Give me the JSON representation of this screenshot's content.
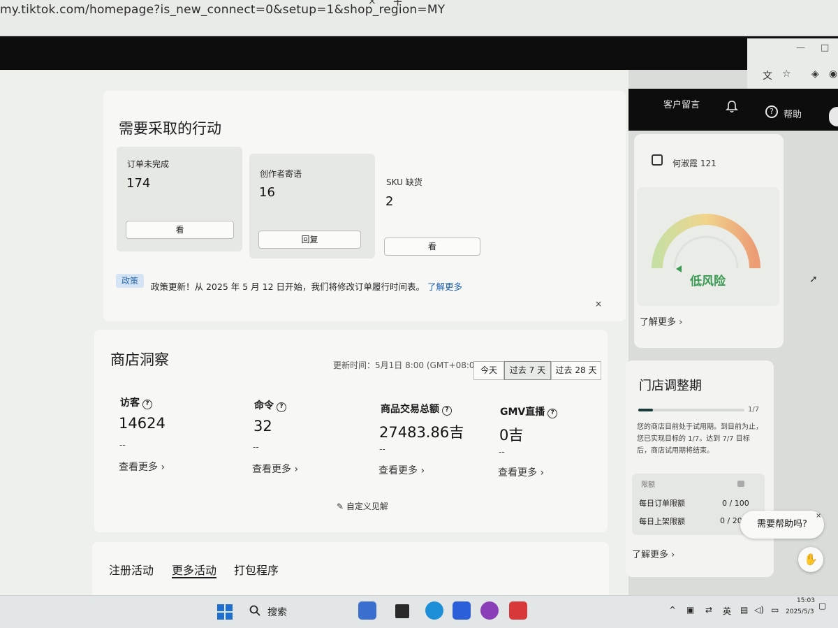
{
  "browser": {
    "url": "my.tiktok.com/homepage?is_new_connect=0&setup=1&shop_region=MY",
    "tab_close": "×",
    "tab_new": "+",
    "win_min": "—",
    "win_max": "□"
  },
  "header": {
    "messages": "客户留言",
    "help": "帮助"
  },
  "actions": {
    "title": "需要采取的行动",
    "items": [
      {
        "label": "订单未完成",
        "value": "174",
        "button": "看"
      },
      {
        "label": "创作者寄语",
        "value": "16",
        "button": "回复"
      },
      {
        "label": "SKU 缺货",
        "value": "2",
        "button": "看"
      }
    ],
    "policy_tag": "政策",
    "policy_text": "政策更新！从 2025 年 5 月 12 日开始，我们将修改订单履行时间表。",
    "policy_link": "了解更多",
    "policy_close": "×"
  },
  "insights": {
    "title": "商店洞察",
    "updated": "更新时间：5月1日 8:00 (GMT+08:00)",
    "ranges": [
      "今天",
      "过去 7 天",
      "过去 28 天"
    ],
    "active_range": "过去 7 天",
    "metrics": [
      {
        "label": "访客",
        "value": "14624",
        "change": "--",
        "more": "查看更多"
      },
      {
        "label": "命令",
        "value": "32",
        "change": "--",
        "more": "查看更多"
      },
      {
        "label": "商品交易总额",
        "value": "27483.86吉",
        "change": "--",
        "more": "查看更多"
      },
      {
        "label": "GMV直播",
        "value": "0吉",
        "change": "--",
        "more": "查看更多"
      }
    ],
    "customize": "自定义见解"
  },
  "tabs": [
    "注册活动",
    "更多活动",
    "打包程序"
  ],
  "active_tab": "更多活动",
  "shop": {
    "name": "何淑霞 121",
    "risk": "低风险",
    "more": "了解更多"
  },
  "trial": {
    "title": "门店调整期",
    "progress_text": "1/7",
    "progress": 0.14,
    "desc": "您的商店目前处于试用期。到目前为止，您已实现目标的 1/7。达到 7/7 目标后，商店试用期将结束。",
    "limit_head": "限额",
    "rows": [
      {
        "label": "每日订单限额",
        "value": "0 / 100"
      },
      {
        "label": "每日上架限额",
        "value": "0 / 20"
      }
    ],
    "more": "了解更多"
  },
  "help_bubble": "需要帮助吗?",
  "taskbar": {
    "search": "搜索",
    "ime": "英",
    "time": "15:03",
    "date": "2025/5/3"
  },
  "colors": {
    "accent_link": "#1c5fb0",
    "risk_green": "#3a9a54",
    "header_dark": "#0d0d0d"
  }
}
